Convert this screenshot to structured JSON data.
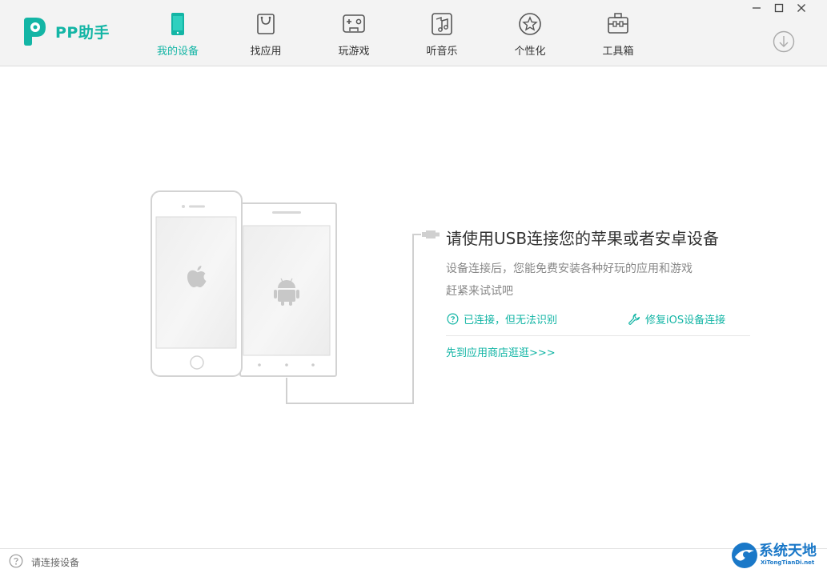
{
  "app": {
    "logo_text": "PP助手"
  },
  "nav": {
    "items": [
      {
        "label": "我的设备",
        "icon": "phone-icon",
        "active": true
      },
      {
        "label": "找应用",
        "icon": "shopping-bag-icon",
        "active": false
      },
      {
        "label": "玩游戏",
        "icon": "gamepad-icon",
        "active": false
      },
      {
        "label": "听音乐",
        "icon": "music-note-icon",
        "active": false
      },
      {
        "label": "个性化",
        "icon": "star-icon",
        "active": false
      },
      {
        "label": "工具箱",
        "icon": "toolbox-icon",
        "active": false
      }
    ]
  },
  "window_controls": [
    "minimize-icon",
    "maximize-icon",
    "close-icon"
  ],
  "main": {
    "title": "请使用USB连接您的苹果或者安卓设备",
    "desc_line1": "设备连接后，您能免费安装各种好玩的应用和游戏",
    "desc_line2": "赶紧来试试吧",
    "link_help": "已连接，但无法识别",
    "link_fix": "修复iOS设备连接",
    "link_store": "先到应用商店逛逛>>>"
  },
  "status": {
    "text": "请连接设备"
  },
  "watermark": {
    "title": "系统天地",
    "subtitle": "XiTongTianDi.net"
  },
  "colors": {
    "accent": "#13b5a5",
    "topbar_bg": "#f3f3f3",
    "illustration_line": "#d6d6d6"
  }
}
